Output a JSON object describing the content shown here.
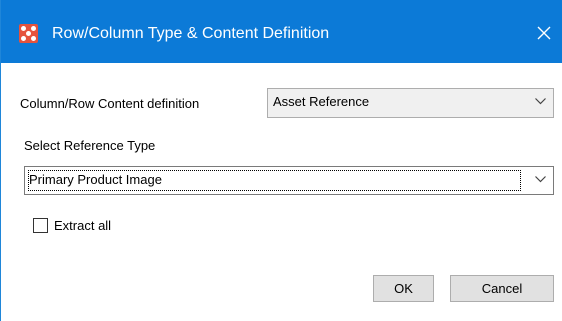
{
  "window": {
    "title": "Row/Column Type & Content Definition",
    "icon": "app-grid-icon",
    "close_icon": "close-icon",
    "titlebar_color": "#0c7ad7"
  },
  "content_definition": {
    "label": "Column/Row Content definition",
    "selected": "Asset Reference"
  },
  "reference_type": {
    "label": "Select Reference Type",
    "selected": "Primary Product Image"
  },
  "extract_all": {
    "label": "Extract all",
    "checked": false
  },
  "buttons": {
    "ok": "OK",
    "cancel": "Cancel"
  }
}
